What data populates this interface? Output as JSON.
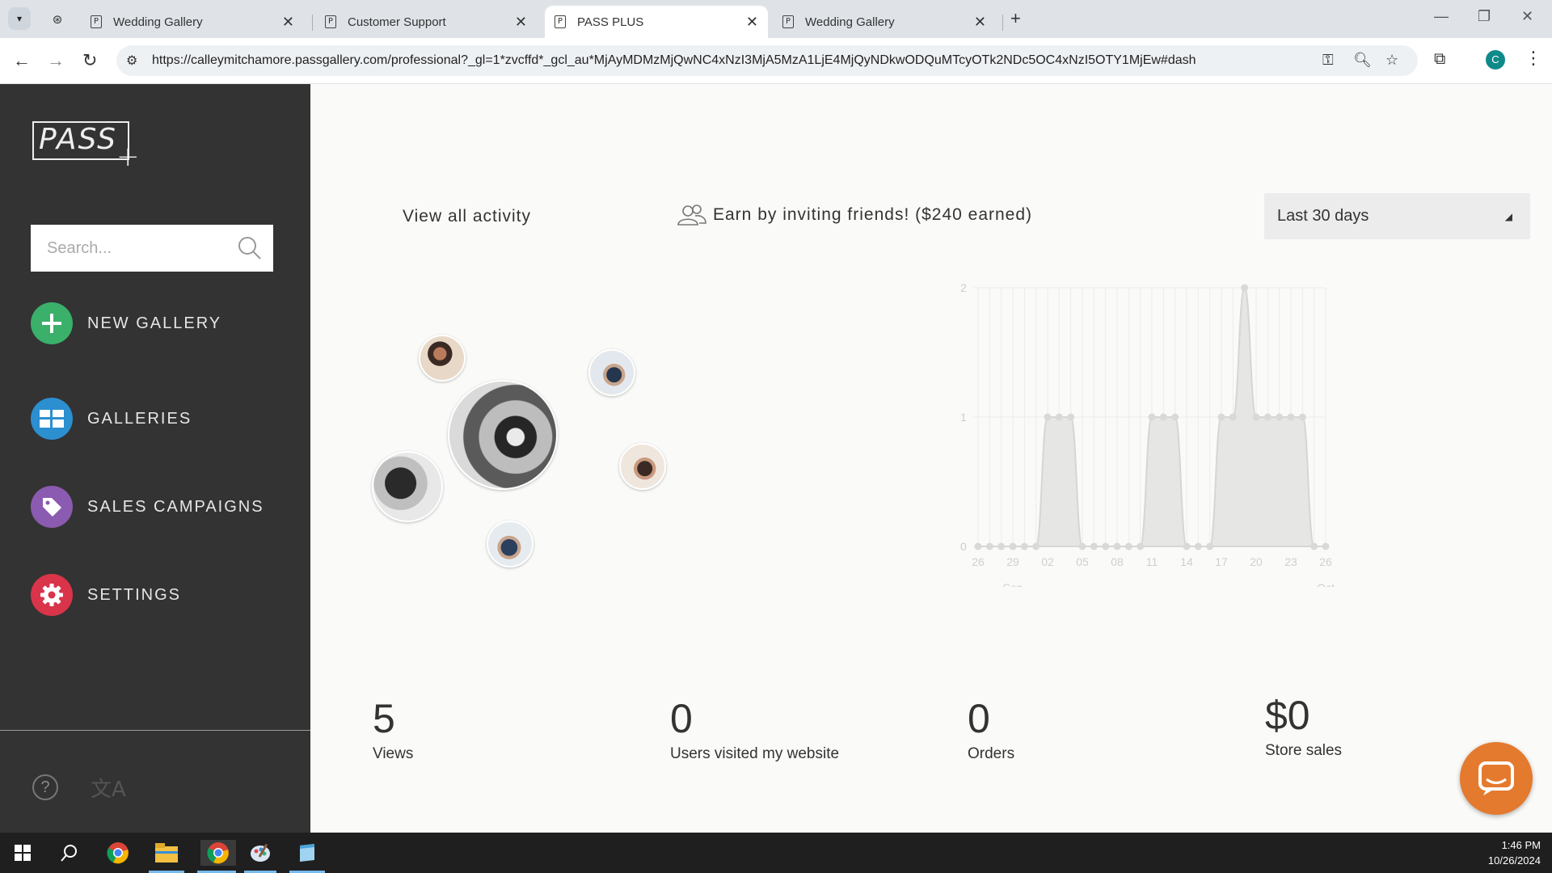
{
  "browser": {
    "tabs": [
      {
        "title": "Wedding Gallery",
        "favicon": "P",
        "active": false
      },
      {
        "title": "Customer Support",
        "favicon": "P",
        "active": false
      },
      {
        "title": "PASS PLUS",
        "favicon": "P",
        "active": true
      },
      {
        "title": "Wedding Gallery",
        "favicon": "P",
        "active": false
      }
    ],
    "url": "https://calleymitchamore.passgallery.com/professional?_gl=1*zvcffd*_gcl_au*MjAyMDMzMjQwNC4xNzI3MjA5MzA1LjE4MjQyNDkwODQuMTcyOTk2NDc5OC4xNzI5OTY1MjEw#dash",
    "profile_initial": "C"
  },
  "sidebar": {
    "logo": "PASS",
    "logo_plus": "+",
    "search_placeholder": "Search...",
    "items": [
      {
        "label": "NEW GALLERY",
        "icon": "plus-icon",
        "color": "#3ab06a"
      },
      {
        "label": "GALLERIES",
        "icon": "grid-icon",
        "color": "#2b8fd0"
      },
      {
        "label": "SALES CAMPAIGNS",
        "icon": "tag-icon",
        "color": "#8a5bb0"
      },
      {
        "label": "SETTINGS",
        "icon": "gear-icon",
        "color": "#d9344a"
      }
    ],
    "help": "?",
    "translate": "文A"
  },
  "main": {
    "view_all": "View all activity",
    "invite": "Earn by inviting friends! ($240 earned)",
    "range": "Last 30 days",
    "stats": [
      {
        "value": "5",
        "label": "Views"
      },
      {
        "value": "0",
        "label": "Users visited my website"
      },
      {
        "value": "0",
        "label": "Orders"
      },
      {
        "value": "$0",
        "label": "Store sales"
      }
    ]
  },
  "chart_data": {
    "type": "area",
    "title": "",
    "xlabel": "",
    "ylabel": "",
    "ylim": [
      0,
      2
    ],
    "y_ticks": [
      "0",
      "1",
      "2"
    ],
    "x_ticks": [
      "26",
      "29",
      "02",
      "05",
      "08",
      "11",
      "14",
      "17",
      "20",
      "23",
      "26"
    ],
    "month_labels": [
      "Sep",
      "Oct"
    ],
    "x": [
      "Sep 26",
      "Sep 27",
      "Sep 28",
      "Sep 29",
      "Sep 30",
      "Oct 01",
      "Oct 02",
      "Oct 03",
      "Oct 04",
      "Oct 05",
      "Oct 06",
      "Oct 07",
      "Oct 08",
      "Oct 09",
      "Oct 10",
      "Oct 11",
      "Oct 12",
      "Oct 13",
      "Oct 14",
      "Oct 15",
      "Oct 16",
      "Oct 17",
      "Oct 18",
      "Oct 19",
      "Oct 20",
      "Oct 21",
      "Oct 22",
      "Oct 23",
      "Oct 24",
      "Oct 25",
      "Oct 26"
    ],
    "series": [
      {
        "values": [
          0,
          0,
          0,
          0,
          0,
          0,
          1,
          1,
          1,
          0,
          0,
          0,
          0,
          0,
          0,
          1,
          1,
          1,
          0,
          0,
          0,
          1,
          1,
          2,
          1,
          1,
          1,
          1,
          1,
          0,
          0
        ]
      }
    ],
    "color": "#d9d9d9",
    "grid": true
  },
  "taskbar": {
    "time": "1:46 PM",
    "date": "10/26/2024"
  }
}
